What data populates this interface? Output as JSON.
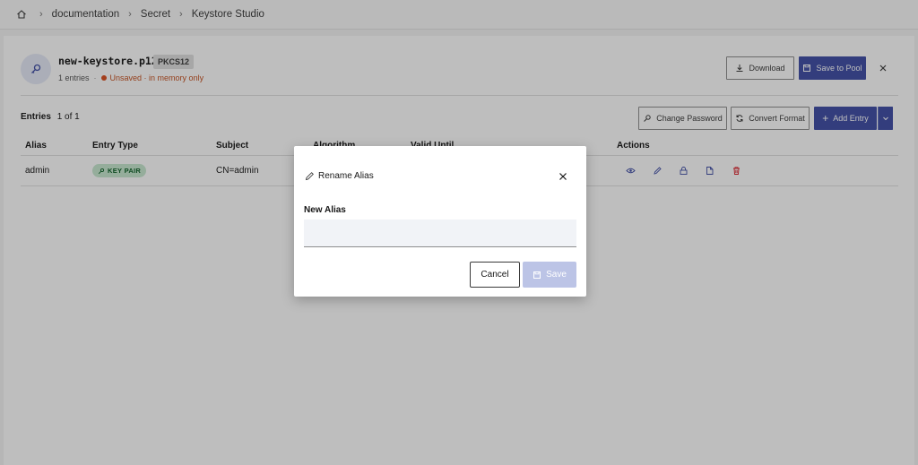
{
  "breadcrumb": {
    "items": [
      "documentation",
      "Secret",
      "Keystore Studio"
    ]
  },
  "keystore": {
    "name": "new-keystore.p12",
    "format": "PKCS12",
    "entries_count": "1 entries",
    "status": "Unsaved · in memory only"
  },
  "header_actions": {
    "download": "Download",
    "save_to_pool": "Save to Pool"
  },
  "entries": {
    "label": "Entries",
    "pagination": "1 of 1"
  },
  "toolbar": {
    "change_password": "Change Password",
    "convert_format": "Convert Format",
    "add_entry": "Add Entry"
  },
  "table": {
    "headers": {
      "alias": "Alias",
      "entry_type": "Entry Type",
      "subject": "Subject",
      "algorithm": "Algorithm",
      "valid_until": "Valid Until",
      "actions": "Actions"
    },
    "rows": [
      {
        "alias": "admin",
        "entry_type": "KEY PAIR",
        "subject": "CN=admin"
      }
    ]
  },
  "modal": {
    "title": "Rename Alias",
    "field_label": "New Alias",
    "field_value": "",
    "cancel": "Cancel",
    "save": "Save"
  },
  "colors": {
    "primary": "#3f4da6",
    "warning": "#da4e1f",
    "success_bg": "#c6e8cf",
    "danger": "#da1e28"
  }
}
